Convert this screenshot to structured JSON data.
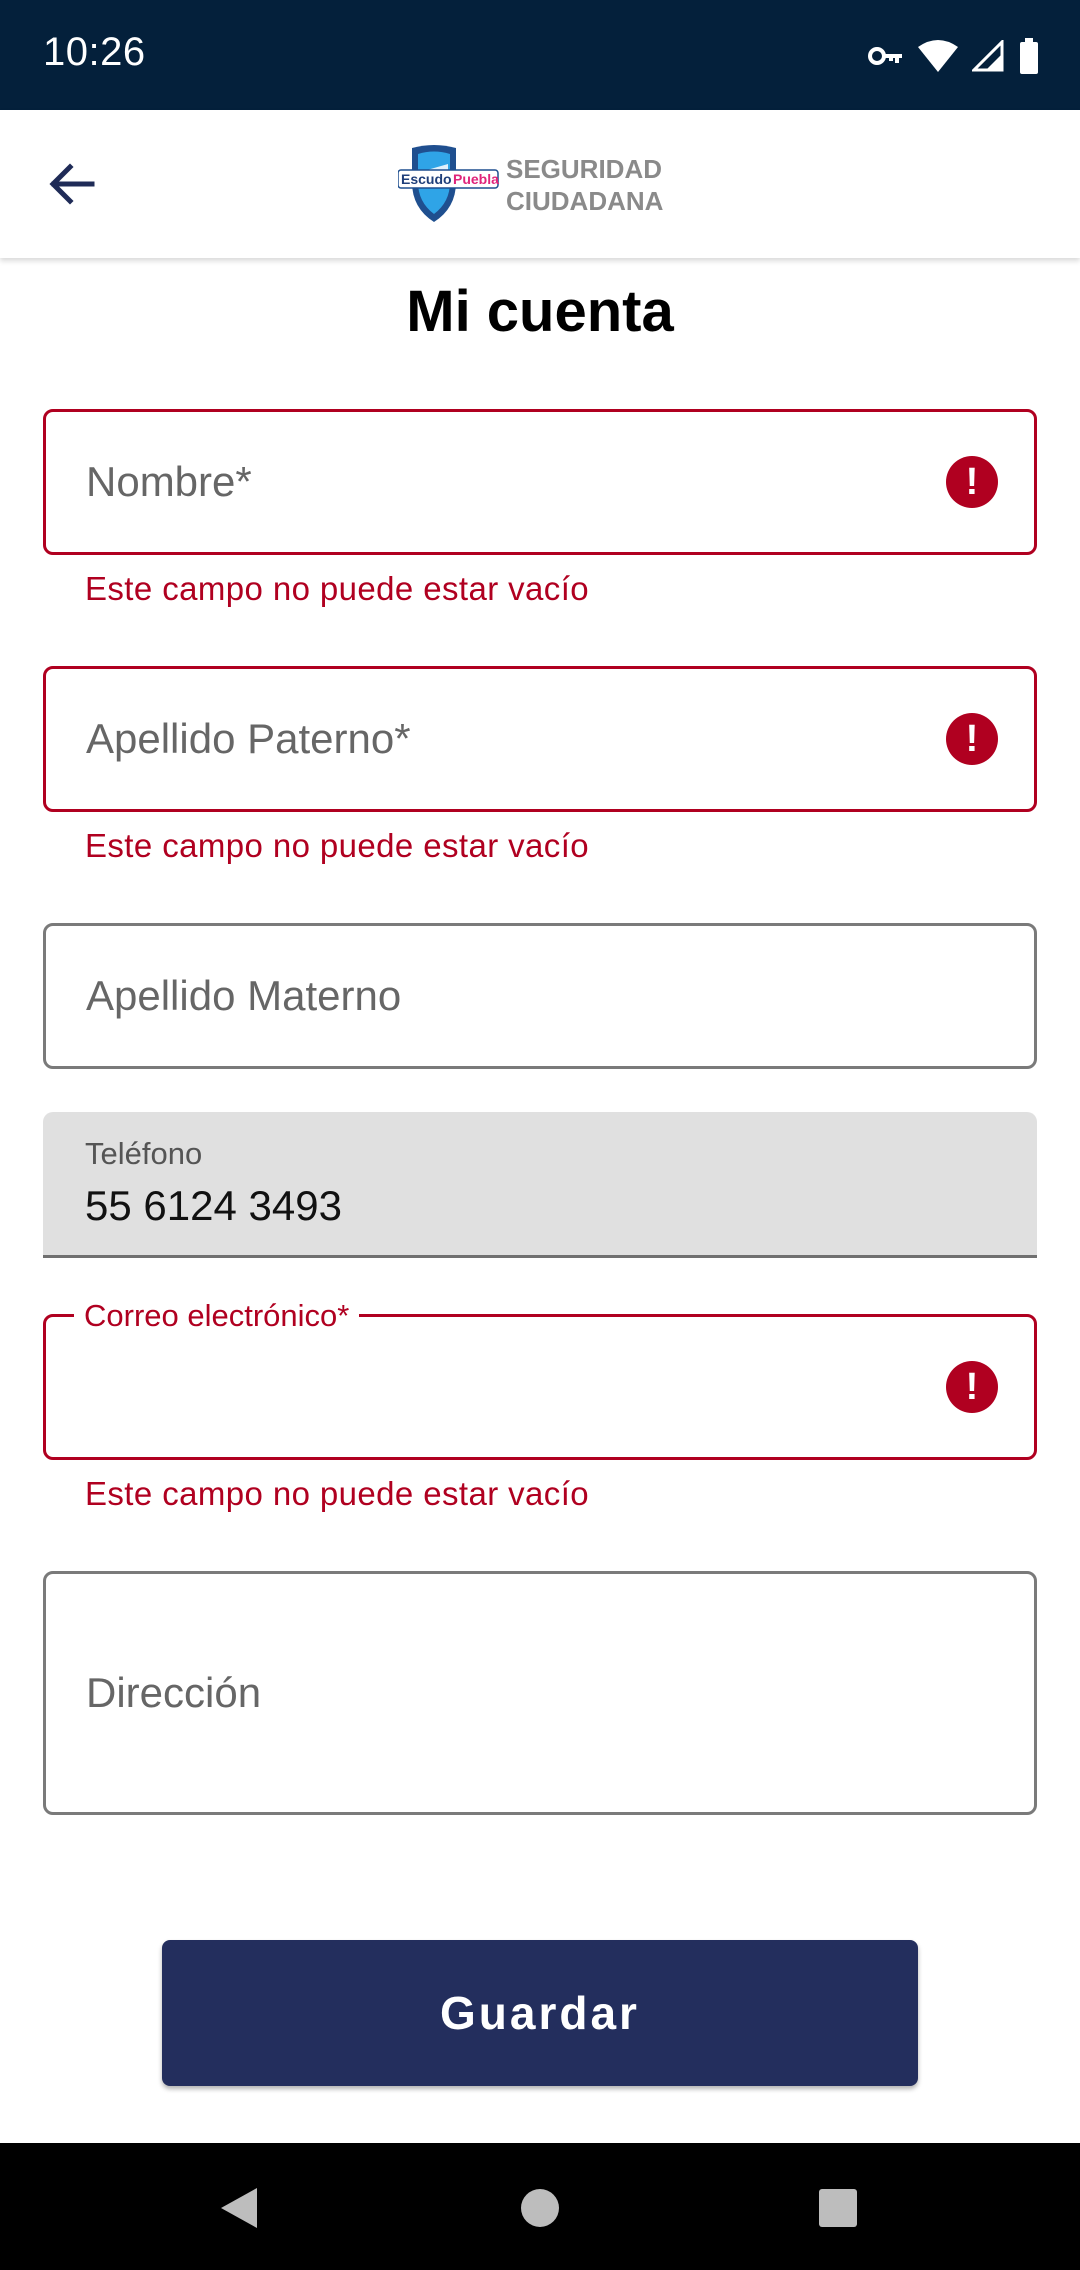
{
  "status_bar": {
    "time": "10:26",
    "icons": [
      "vpn-key-icon",
      "wifi-icon",
      "signal-icon",
      "battery-icon"
    ]
  },
  "app_bar": {
    "back_icon": "arrow-left-icon",
    "logo": {
      "brand_part1": "Escudo",
      "brand_part2": "Puebla",
      "line1": "SEGURIDAD",
      "line2": "CIUDADANA"
    }
  },
  "page": {
    "title": "Mi cuenta"
  },
  "form": {
    "nombre": {
      "placeholder": "Nombre*",
      "error": "Este campo no puede estar vacío"
    },
    "apellido_paterno": {
      "placeholder": "Apellido Paterno*",
      "error": "Este campo no puede estar vacío"
    },
    "apellido_materno": {
      "placeholder": "Apellido Materno"
    },
    "telefono": {
      "label": "Teléfono",
      "value": "55 6124 3493"
    },
    "correo": {
      "label": "Correo electrónico*",
      "value": "",
      "error": "Este campo no puede estar vacío"
    },
    "direccion": {
      "placeholder": "Dirección"
    },
    "error_icon_glyph": "!"
  },
  "actions": {
    "save_label": "Guardar"
  },
  "colors": {
    "status_bar": "#04203b",
    "error": "#b00020",
    "primary_button": "#232e5d"
  },
  "nav_bar": {
    "icons": [
      "back-triangle-icon",
      "home-circle-icon",
      "recents-square-icon"
    ]
  }
}
